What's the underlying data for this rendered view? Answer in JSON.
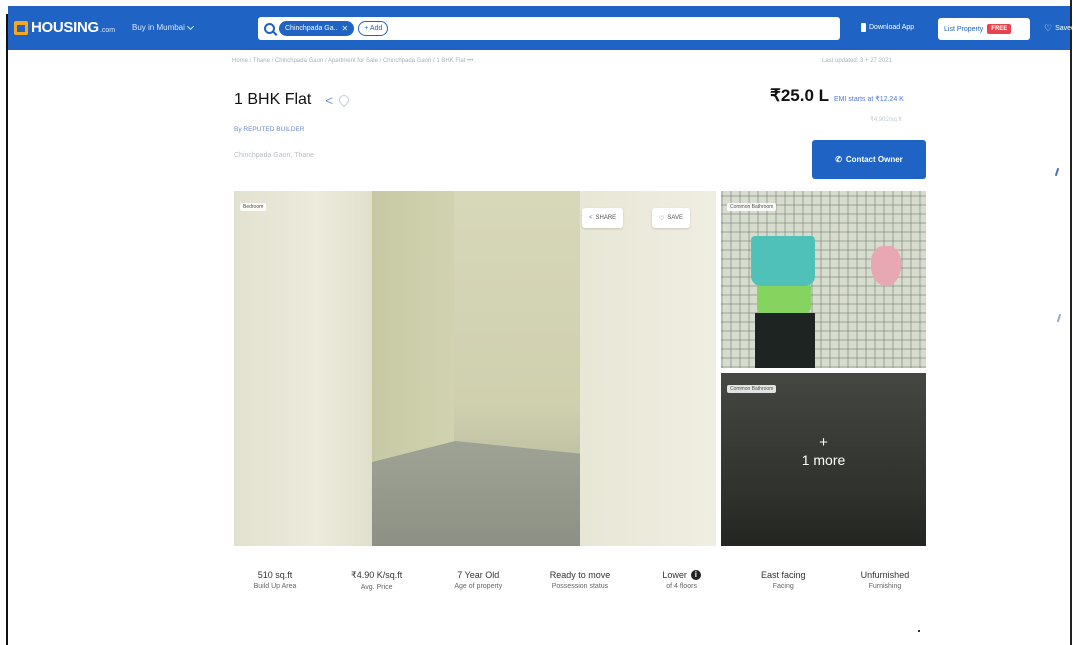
{
  "nav": {
    "brand": "HOUSING",
    "brand_suffix": ".com",
    "city_label": "Buy in Mumbai",
    "search_chip": "Chinchpada Ga..",
    "chip_close": "✕",
    "add_label": "+ Add",
    "download_label": "Download App",
    "list_property_label": "List Property",
    "free_badge": "FREE",
    "saved_label": "Saved",
    "brand_color": "#1f63c4"
  },
  "breadcrumb": {
    "text": "Home / Thane / Chinchpada Gaon / Apartment for Sale / Chinchpada Gaon / 1 BHK Flat",
    "more": "•••",
    "posted_on": "Last updated: 3 + 27 2021"
  },
  "listing": {
    "title": "1 BHK Flat",
    "builder": "By REPUTED BUILDER",
    "locality": "Chinchpada Gaon, Thane",
    "price": "₹25.0 L",
    "emi": "EMI starts at ₹12.24 K",
    "price_note": "₹4,902/sq.ft",
    "contact_label": "Contact Owner"
  },
  "gallery": {
    "main_tag": "Bedroom",
    "share_label": "SHARE",
    "save_label": "SAVE",
    "thumb1_tag": "Common Bathroom",
    "thumb2_tag": "Common Bathroom",
    "more_plus": "+",
    "more_label": "1 more"
  },
  "stats": [
    {
      "value": "510 sq.ft",
      "label": "Build Up Area"
    },
    {
      "value": "₹4.90 K/sq.ft",
      "label": "Avg. Price"
    },
    {
      "value": "7 Year Old",
      "label": "Age of property"
    },
    {
      "value": "Ready to move",
      "label": "Possession status"
    },
    {
      "value": "Lower",
      "label": "of 4 floors"
    },
    {
      "value": "East facing",
      "label": "Facing"
    },
    {
      "value": "Unfurnished",
      "label": "Furnishing"
    }
  ]
}
